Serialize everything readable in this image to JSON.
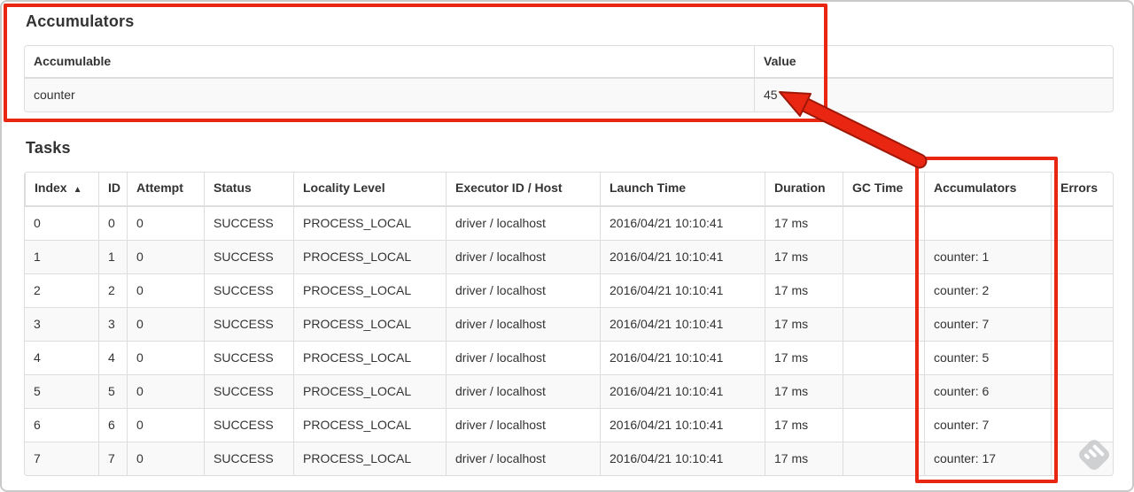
{
  "colors": {
    "annotation_red": "#e82612",
    "annotation_red_dark": "#9e1707",
    "watermark_gray": "#c7c9cb"
  },
  "accumulators_section": {
    "title": "Accumulators",
    "table": {
      "columns": [
        "Accumulable",
        "Value"
      ],
      "rows": [
        {
          "name": "counter",
          "value": "45"
        }
      ]
    }
  },
  "tasks_section": {
    "title": "Tasks",
    "table": {
      "columns": [
        {
          "label": "Index",
          "sort_icon": "▲"
        },
        {
          "label": "ID",
          "sort_icon": ""
        },
        {
          "label": "Attempt",
          "sort_icon": ""
        },
        {
          "label": "Status",
          "sort_icon": ""
        },
        {
          "label": "Locality Level",
          "sort_icon": ""
        },
        {
          "label": "Executor ID / Host",
          "sort_icon": ""
        },
        {
          "label": "Launch Time",
          "sort_icon": ""
        },
        {
          "label": "Duration",
          "sort_icon": ""
        },
        {
          "label": "GC Time",
          "sort_icon": ""
        },
        {
          "label": "Accumulators",
          "sort_icon": ""
        },
        {
          "label": "Errors",
          "sort_icon": ""
        }
      ],
      "rows": [
        {
          "index": "0",
          "id": "0",
          "attempt": "0",
          "status": "SUCCESS",
          "locality": "PROCESS_LOCAL",
          "executor": "driver / localhost",
          "launch_time": "2016/04/21 10:10:41",
          "duration": "17 ms",
          "gc_time": "",
          "accumulators": "",
          "errors": ""
        },
        {
          "index": "1",
          "id": "1",
          "attempt": "0",
          "status": "SUCCESS",
          "locality": "PROCESS_LOCAL",
          "executor": "driver / localhost",
          "launch_time": "2016/04/21 10:10:41",
          "duration": "17 ms",
          "gc_time": "",
          "accumulators": "counter: 1",
          "errors": ""
        },
        {
          "index": "2",
          "id": "2",
          "attempt": "0",
          "status": "SUCCESS",
          "locality": "PROCESS_LOCAL",
          "executor": "driver / localhost",
          "launch_time": "2016/04/21 10:10:41",
          "duration": "17 ms",
          "gc_time": "",
          "accumulators": "counter: 2",
          "errors": ""
        },
        {
          "index": "3",
          "id": "3",
          "attempt": "0",
          "status": "SUCCESS",
          "locality": "PROCESS_LOCAL",
          "executor": "driver / localhost",
          "launch_time": "2016/04/21 10:10:41",
          "duration": "17 ms",
          "gc_time": "",
          "accumulators": "counter: 7",
          "errors": ""
        },
        {
          "index": "4",
          "id": "4",
          "attempt": "0",
          "status": "SUCCESS",
          "locality": "PROCESS_LOCAL",
          "executor": "driver / localhost",
          "launch_time": "2016/04/21 10:10:41",
          "duration": "17 ms",
          "gc_time": "",
          "accumulators": "counter: 5",
          "errors": ""
        },
        {
          "index": "5",
          "id": "5",
          "attempt": "0",
          "status": "SUCCESS",
          "locality": "PROCESS_LOCAL",
          "executor": "driver / localhost",
          "launch_time": "2016/04/21 10:10:41",
          "duration": "17 ms",
          "gc_time": "",
          "accumulators": "counter: 6",
          "errors": ""
        },
        {
          "index": "6",
          "id": "6",
          "attempt": "0",
          "status": "SUCCESS",
          "locality": "PROCESS_LOCAL",
          "executor": "driver / localhost",
          "launch_time": "2016/04/21 10:10:41",
          "duration": "17 ms",
          "gc_time": "",
          "accumulators": "counter: 7",
          "errors": ""
        },
        {
          "index": "7",
          "id": "7",
          "attempt": "0",
          "status": "SUCCESS",
          "locality": "PROCESS_LOCAL",
          "executor": "driver / localhost",
          "launch_time": "2016/04/21 10:10:41",
          "duration": "17 ms",
          "gc_time": "",
          "accumulators": "counter: 17",
          "errors": ""
        }
      ]
    }
  },
  "watermark_icon": "feedly-logo"
}
